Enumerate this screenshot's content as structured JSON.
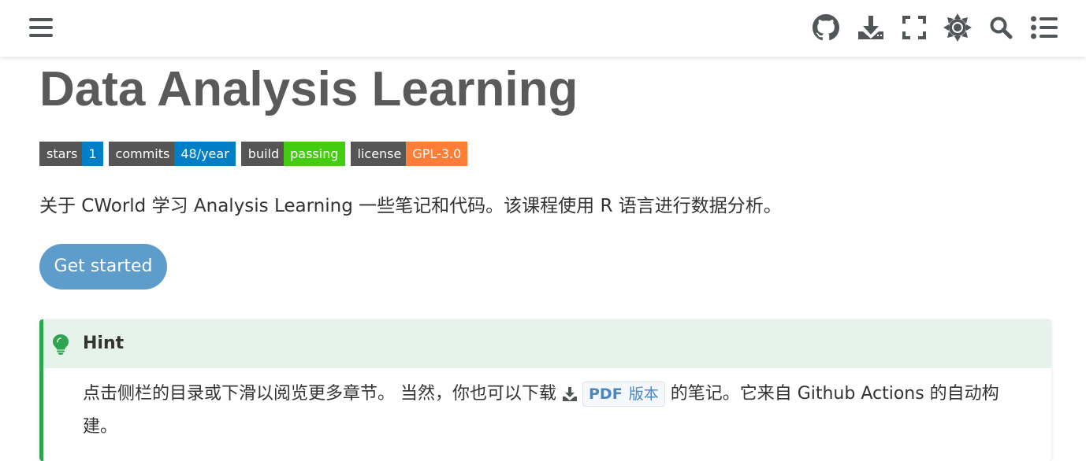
{
  "toolbar": {
    "icons": [
      "menu-icon",
      "github-icon",
      "download-icon",
      "fullscreen-icon",
      "theme-icon",
      "search-icon",
      "toc-icon"
    ]
  },
  "page": {
    "title": "Data Analysis Learning",
    "description": "关于 CWorld 学习 Analysis Learning 一些笔记和代码。该课程使用 R 语言进行数据分析。",
    "get_started_label": "Get started"
  },
  "badges": [
    {
      "key": "stars",
      "value": "1",
      "color": "#007ec6"
    },
    {
      "key": "commits",
      "value": "48/year",
      "color": "#007ec6"
    },
    {
      "key": "build",
      "value": "passing",
      "color": "#44cc11"
    },
    {
      "key": "license",
      "value": "GPL-3.0",
      "color": "#fe7d37"
    }
  ],
  "hint": {
    "title": "Hint",
    "text_before": "点击侧栏的目录或下滑以阅览更多章节。 当然，你也可以下载 ",
    "pdf_label": "PDF",
    "pdf_suffix": "版本",
    "text_after": " 的笔记。它来自 Github Actions 的自动构建。",
    "accent_color": "#2ea44f",
    "header_bg": "#e6f3ea"
  },
  "colors": {
    "button": "#5e9ccc",
    "title": "#5a5a5a"
  }
}
